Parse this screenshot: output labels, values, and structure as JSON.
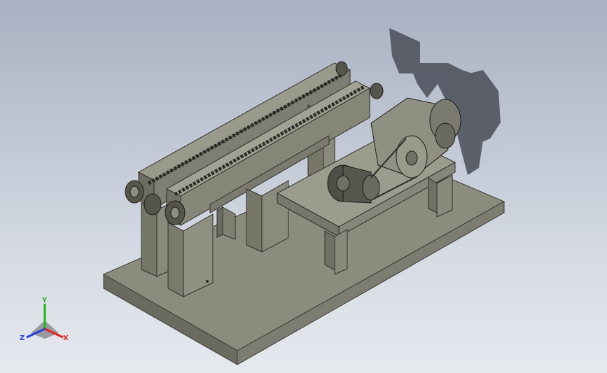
{
  "viewport": {
    "background_top": "#a8b1c2",
    "background_bottom": "#e6e9ee",
    "model_color": "#8c8c7e",
    "shadow_color": "#4a4e58"
  },
  "triad": {
    "x_label": "X",
    "y_label": "Y",
    "z_label": "Z",
    "x_color": "#e02020",
    "y_color": "#20b020",
    "z_color": "#2040e0"
  }
}
